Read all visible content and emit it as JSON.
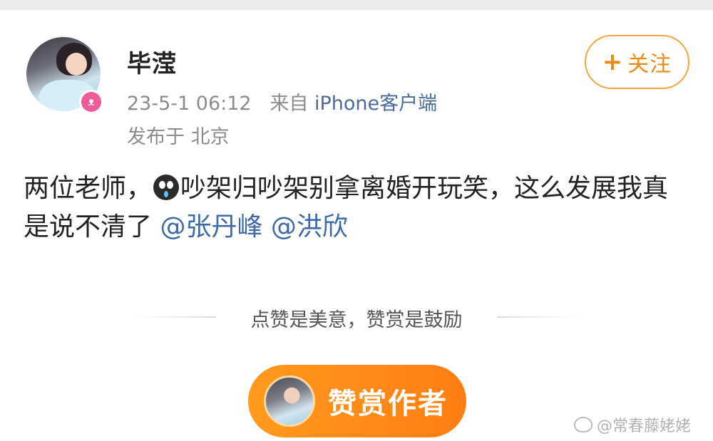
{
  "colors": {
    "follow_accent": "#ec8b14",
    "reward_button": "#ff8a18",
    "mention": "#3d6aa8",
    "meta_gray": "#8c8c8c",
    "badge_pink": "#f05c99"
  },
  "user": {
    "name": "毕滢",
    "avatar_icon": "user-avatar",
    "badge_icon": "rabbit-badge-icon"
  },
  "meta": {
    "time": "23-5-1 06:12",
    "from_prefix": "来自",
    "source": "iPhone客户端",
    "location": "发布于 北京"
  },
  "follow": {
    "plus": "+",
    "label": "关注"
  },
  "post": {
    "text_before_emoji": "两位老师，",
    "emoji_icon": "crying-face-emoji-icon",
    "text_after_emoji": "吵架归吵架别拿离婚开玩笑，这么发展我真是说不清了 ",
    "mentions": [
      "@张丹峰",
      "@洪欣"
    ]
  },
  "reward": {
    "caption": "点赞是美意，赞赏是鼓励",
    "button_label": "赞赏作者"
  },
  "watermark": {
    "icon": "weibo-icon",
    "text": "@常春藤姥姥"
  }
}
